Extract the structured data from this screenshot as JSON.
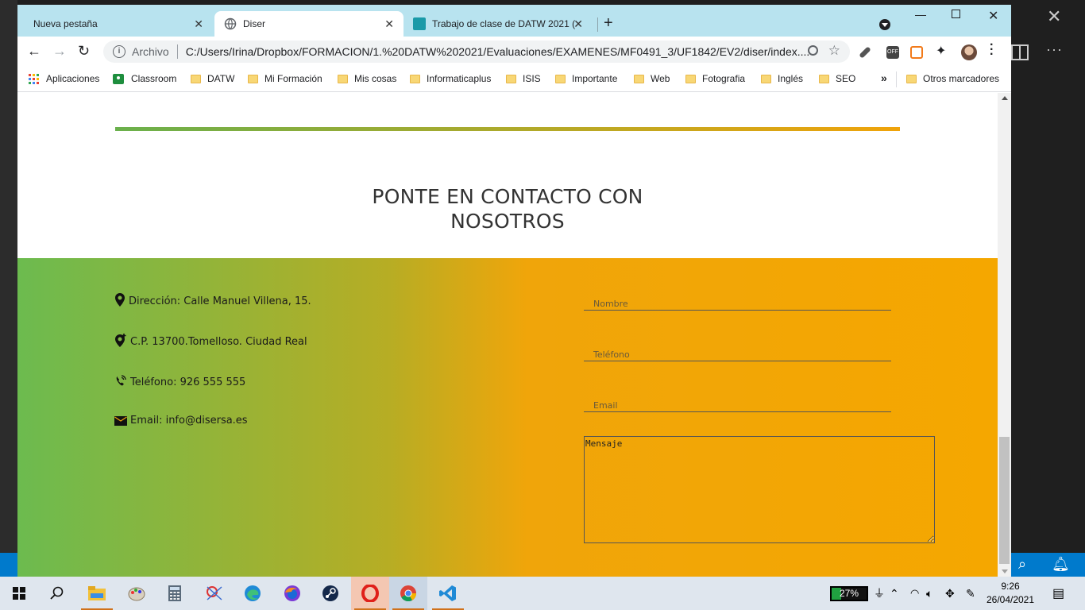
{
  "browser": {
    "tabs": [
      {
        "label": "Nueva pestaña"
      },
      {
        "label": "Diser"
      },
      {
        "label": "Trabajo de clase de DATW 2021 ("
      }
    ],
    "omnibox": {
      "scheme": "Archivo",
      "url": "C:/Users/Irina/Dropbox/FORMACION/1.%20DATW%202021/Evaluaciones/EXAMENES/MF0491_3/UF1842/EV2/diser/index...."
    },
    "bookmarks": [
      {
        "label": "Aplicaciones"
      },
      {
        "label": "Classroom"
      },
      {
        "label": "DATW"
      },
      {
        "label": "Mi Formación"
      },
      {
        "label": "Mis cosas"
      },
      {
        "label": "Informaticaplus"
      },
      {
        "label": "ISIS"
      },
      {
        "label": "Importante"
      },
      {
        "label": "Web"
      },
      {
        "label": "Fotografia"
      },
      {
        "label": "Inglés"
      },
      {
        "label": "SEO"
      },
      {
        "label": "Otros marcadores"
      }
    ],
    "more_bookmarks": "»"
  },
  "page": {
    "contact_title_line1": "PONTE EN CONTACTO CON",
    "contact_title_line2": "NOSOTROS",
    "info": {
      "address": "Dirección: Calle Manuel Villena, 15.",
      "postal": "C.P. 13700.Tomelloso. Ciudad Real",
      "phone": "Teléfono: 926 555 555",
      "email": "Email: info@disersa.es"
    },
    "form": {
      "name_placeholder": "Nombre",
      "phone_placeholder": "Teléfono",
      "email_placeholder": "Email",
      "message_placeholder": "Mensaje"
    },
    "colors": {
      "gradient_start": "#6cbb4f",
      "gradient_end": "#f5a700",
      "title_text": "#333333"
    }
  },
  "taskbar": {
    "battery": "27%",
    "time": "9:26",
    "date": "26/04/2021"
  }
}
